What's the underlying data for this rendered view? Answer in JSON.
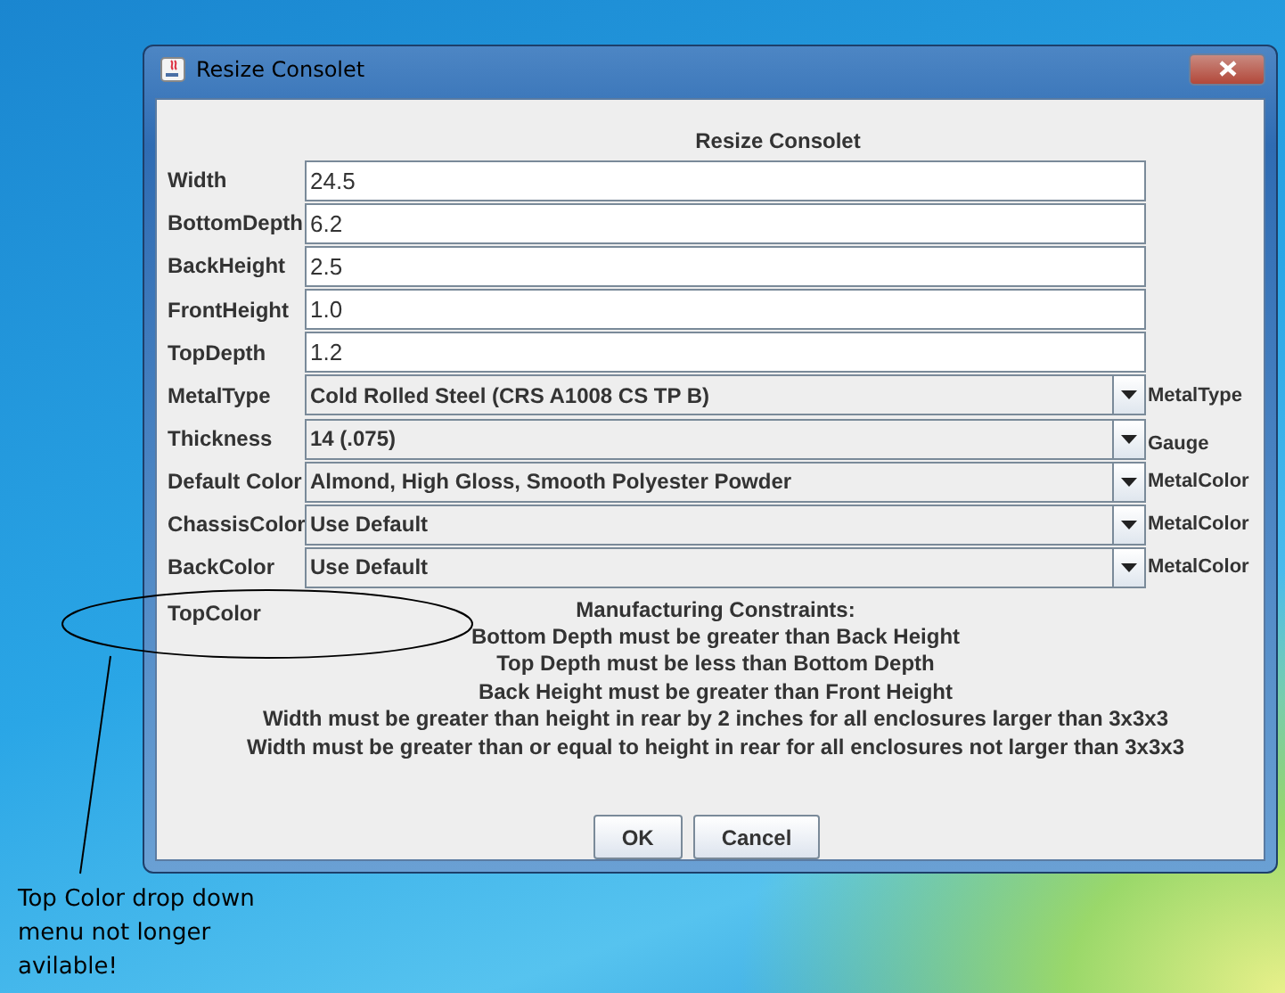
{
  "window": {
    "title": "Resize Consolet"
  },
  "heading": "Resize Consolet",
  "fields": [
    {
      "kind": "text",
      "label": "Width",
      "value": "24.5"
    },
    {
      "kind": "text",
      "label": "BottomDepth",
      "value": "6.2"
    },
    {
      "kind": "text",
      "label": "BackHeight",
      "value": "2.5"
    },
    {
      "kind": "text",
      "label": "FrontHeight",
      "value": "1.0"
    },
    {
      "kind": "text",
      "label": "TopDepth",
      "value": "1.2"
    },
    {
      "kind": "dropdown",
      "label": "MetalType",
      "value": "Cold Rolled Steel (CRS A1008 CS TP B)",
      "side_label": "MetalType"
    },
    {
      "kind": "dropdown",
      "label": "Thickness",
      "value": "14 (.075)",
      "side_label": "Gauge"
    },
    {
      "kind": "dropdown",
      "label": "Default Color",
      "value": "Almond, High Gloss, Smooth Polyester Powder",
      "side_label": "MetalColor"
    },
    {
      "kind": "dropdown",
      "label": "ChassisColor",
      "value": "Use Default",
      "side_label": "MetalColor"
    },
    {
      "kind": "dropdown",
      "label": "BackColor",
      "value": "Use Default",
      "side_label": "MetalColor"
    }
  ],
  "top_color_label": "TopColor",
  "constraints": {
    "title": "Manufacturing Constraints:",
    "lines": [
      "Bottom Depth must be greater than Back Height",
      "Top Depth must be less than Bottom Depth",
      "Back Height must be greater than Front Height",
      "Width must be greater than height in rear by 2 inches for all enclosures larger than 3x3x3",
      "Width must be greater than or equal to height in rear for all enclosures not larger than 3x3x3"
    ]
  },
  "buttons": [
    "OK",
    "Cancel"
  ],
  "annotation": "Top Color drop down menu not longer avilable!"
}
